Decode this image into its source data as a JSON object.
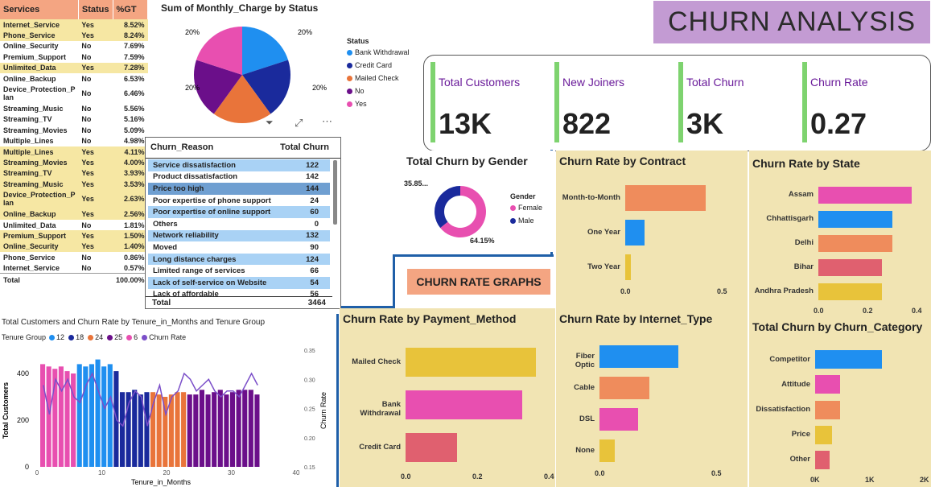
{
  "services_table": {
    "headers": [
      "Services",
      "Status",
      "%GT"
    ],
    "rows": [
      [
        "Internet_Service",
        "Yes",
        "8.52%"
      ],
      [
        "Phone_Service",
        "Yes",
        "8.24%"
      ],
      [
        "Online_Security",
        "No",
        "7.69%"
      ],
      [
        "Premium_Support",
        "No",
        "7.59%"
      ],
      [
        "Unlimited_Data",
        "Yes",
        "7.28%"
      ],
      [
        "Online_Backup",
        "No",
        "6.53%"
      ],
      [
        "Device_Protection_P lan",
        "No",
        "6.46%"
      ],
      [
        "Streaming_Music",
        "No",
        "5.56%"
      ],
      [
        "Streaming_TV",
        "No",
        "5.16%"
      ],
      [
        "Streaming_Movies",
        "No",
        "5.09%"
      ],
      [
        "Multiple_Lines",
        "No",
        "4.98%"
      ],
      [
        "Multiple_Lines",
        "Yes",
        "4.11%"
      ],
      [
        "Streaming_Movies",
        "Yes",
        "4.00%"
      ],
      [
        "Streaming_TV",
        "Yes",
        "3.93%"
      ],
      [
        "Streaming_Music",
        "Yes",
        "3.53%"
      ],
      [
        "Device_Protection_P lan",
        "Yes",
        "2.63%"
      ],
      [
        "Online_Backup",
        "Yes",
        "2.56%"
      ],
      [
        "Unlimited_Data",
        "No",
        "1.81%"
      ],
      [
        "Premium_Support",
        "Yes",
        "1.50%"
      ],
      [
        "Online_Security",
        "Yes",
        "1.40%"
      ],
      [
        "Phone_Service",
        "No",
        "0.86%"
      ],
      [
        "Internet_Service",
        "No",
        "0.57%"
      ]
    ],
    "total_label": "Total",
    "total_value": "100.00%"
  },
  "pie": {
    "title": "Sum of Monthly_Charge by Status",
    "legend_title": "Status",
    "legend": [
      [
        "Bank Withdrawal",
        "#1f8ff0"
      ],
      [
        "Credit Card",
        "#1a2a9c"
      ],
      [
        "Mailed Check",
        "#e9743a"
      ],
      [
        "No",
        "#6b0f8a"
      ],
      [
        "Yes",
        "#e84fb0"
      ]
    ],
    "slices": [
      20,
      20,
      20,
      20,
      20
    ],
    "labels": [
      "20%",
      "20%",
      "20%",
      "20%"
    ]
  },
  "banner": "CHURN ANALYSIS",
  "kpis": [
    {
      "label": "Total Customers",
      "value": "13K"
    },
    {
      "label": "New Joiners",
      "value": "822"
    },
    {
      "label": "Total Churn",
      "value": "3K"
    },
    {
      "label": "Churn Rate",
      "value": "0.27"
    }
  ],
  "reason_table": {
    "headers": [
      "Churn_Reason",
      "Total Churn"
    ],
    "rows": [
      [
        "Service dissatisfaction",
        "122"
      ],
      [
        "Product dissatisfaction",
        "142"
      ],
      [
        "Price too high",
        "144"
      ],
      [
        "Poor expertise of phone support",
        "24"
      ],
      [
        "Poor expertise of online support",
        "60"
      ],
      [
        "Others",
        "0"
      ],
      [
        "Network reliability",
        "132"
      ],
      [
        "Moved",
        "90"
      ],
      [
        "Long distance charges",
        "124"
      ],
      [
        "Limited range of services",
        "66"
      ],
      [
        "Lack of self-service on Website",
        "54"
      ],
      [
        "Lack of affordable",
        "56"
      ]
    ],
    "total_label": "Total",
    "total_value": "3464"
  },
  "gender": {
    "title": "Total Churn by Gender",
    "legend_title": "Gender",
    "legend": [
      [
        "Female",
        "#e84fb0"
      ],
      [
        "Male",
        "#1a2a9c"
      ]
    ],
    "label_small": "35.85...",
    "label_big": "64.15%",
    "values": [
      64.15,
      35.85
    ]
  },
  "churn_rate_graphs_label": "CHURN RATE GRAPHS",
  "contract": {
    "title": "Churn Rate by Contract",
    "categories": [
      "Month-to-Month",
      "One Year",
      "Two Year"
    ],
    "values": [
      0.46,
      0.11,
      0.03
    ],
    "colors": [
      "#ef8c5c",
      "#1f8ff0",
      "#e8c33a"
    ],
    "ticks": [
      "0.0",
      "0.5"
    ],
    "xmax": 0.55
  },
  "state": {
    "title": "Churn Rate by State",
    "categories": [
      "Assam",
      "Chhattisgarh",
      "Delhi",
      "Bihar",
      "Andhra Pradesh"
    ],
    "values": [
      0.38,
      0.3,
      0.3,
      0.26,
      0.26
    ],
    "colors": [
      "#e84fb0",
      "#1f8ff0",
      "#ef8c5c",
      "#e0606f",
      "#e8c33a"
    ],
    "ticks": [
      "0.0",
      "0.2",
      "0.4"
    ],
    "xmax": 0.4
  },
  "payment": {
    "title": "Churn Rate by Payment_Method",
    "categories": [
      "Mailed Check",
      "Bank Withdrawal",
      "Credit Card"
    ],
    "values": [
      0.38,
      0.34,
      0.15
    ],
    "colors": [
      "#e8c33a",
      "#e84fb0",
      "#e0606f"
    ],
    "ticks": [
      "0.0",
      "0.2",
      "0.4"
    ],
    "xmax": 0.4
  },
  "internet": {
    "title": "Churn Rate by Internet_Type",
    "categories": [
      "Fiber Optic",
      "Cable",
      "DSL",
      "None"
    ],
    "values": [
      0.41,
      0.26,
      0.2,
      0.08
    ],
    "colors": [
      "#1f8ff0",
      "#ef8c5c",
      "#e84fb0",
      "#e8c33a"
    ],
    "ticks": [
      "0.0",
      "0.5"
    ],
    "xmax": 0.55
  },
  "category": {
    "title": "Total Churn by Churn_Category",
    "categories": [
      "Competitor",
      "Attitude",
      "Dissatisfaction",
      "Price",
      "Other"
    ],
    "values": [
      1600,
      600,
      600,
      400,
      350
    ],
    "colors": [
      "#1f8ff0",
      "#e84fb0",
      "#ef8c5c",
      "#e8c33a",
      "#e0606f"
    ],
    "ticks": [
      "0K",
      "1K",
      "2K"
    ],
    "xmax": 2000
  },
  "tenure": {
    "title": "Total Customers and Churn Rate by Tenure_in_Months and Tenure Group",
    "legend_title": "Tenure Group",
    "legend": [
      [
        "12",
        "#1f8ff0"
      ],
      [
        "18",
        "#1a2a9c"
      ],
      [
        "24",
        "#e9743a"
      ],
      [
        "25",
        "#6b0f8a"
      ],
      [
        "6",
        "#e84fb0"
      ],
      [
        "Churn Rate",
        "#7b4fc9"
      ]
    ],
    "ylabel": "Total Customers",
    "y2label": "Churn Rate",
    "xlabel": "Tenure_in_Months",
    "y_ticks": [
      "0",
      "200",
      "400"
    ],
    "y2_ticks": [
      "0.15",
      "0.20",
      "0.25",
      "0.30",
      "0.35"
    ],
    "x_ticks": [
      "0",
      "10",
      "20",
      "30",
      "40"
    ],
    "bars": [
      440,
      430,
      420,
      430,
      410,
      400,
      440,
      430,
      440,
      460,
      430,
      440,
      410,
      320,
      320,
      330,
      310,
      320,
      320,
      310,
      300,
      310,
      320,
      320,
      310,
      310,
      330,
      310,
      320,
      330,
      310,
      320,
      330,
      330,
      330,
      310
    ],
    "colors": [
      "#e84fb0",
      "#e84fb0",
      "#e84fb0",
      "#e84fb0",
      "#e84fb0",
      "#e84fb0",
      "#1f8ff0",
      "#1f8ff0",
      "#1f8ff0",
      "#1f8ff0",
      "#1f8ff0",
      "#1f8ff0",
      "#1a2a9c",
      "#1a2a9c",
      "#1a2a9c",
      "#1a2a9c",
      "#1a2a9c",
      "#1a2a9c",
      "#e9743a",
      "#e9743a",
      "#e9743a",
      "#e9743a",
      "#e9743a",
      "#e9743a",
      "#6b0f8a",
      "#6b0f8a",
      "#6b0f8a",
      "#6b0f8a",
      "#6b0f8a",
      "#6b0f8a",
      "#6b0f8a",
      "#6b0f8a",
      "#6b0f8a",
      "#6b0f8a",
      "#6b0f8a",
      "#6b0f8a"
    ],
    "rate": [
      0.29,
      0.24,
      0.3,
      0.28,
      0.3,
      0.27,
      0.26,
      0.29,
      0.31,
      0.28,
      0.25,
      0.27,
      0.23,
      0.22,
      0.26,
      0.28,
      0.27,
      0.22,
      0.26,
      0.29,
      0.24,
      0.27,
      0.28,
      0.31,
      0.3,
      0.28,
      0.29,
      0.3,
      0.28,
      0.27,
      0.28,
      0.28,
      0.27,
      0.29,
      0.31,
      0.29
    ]
  }
}
